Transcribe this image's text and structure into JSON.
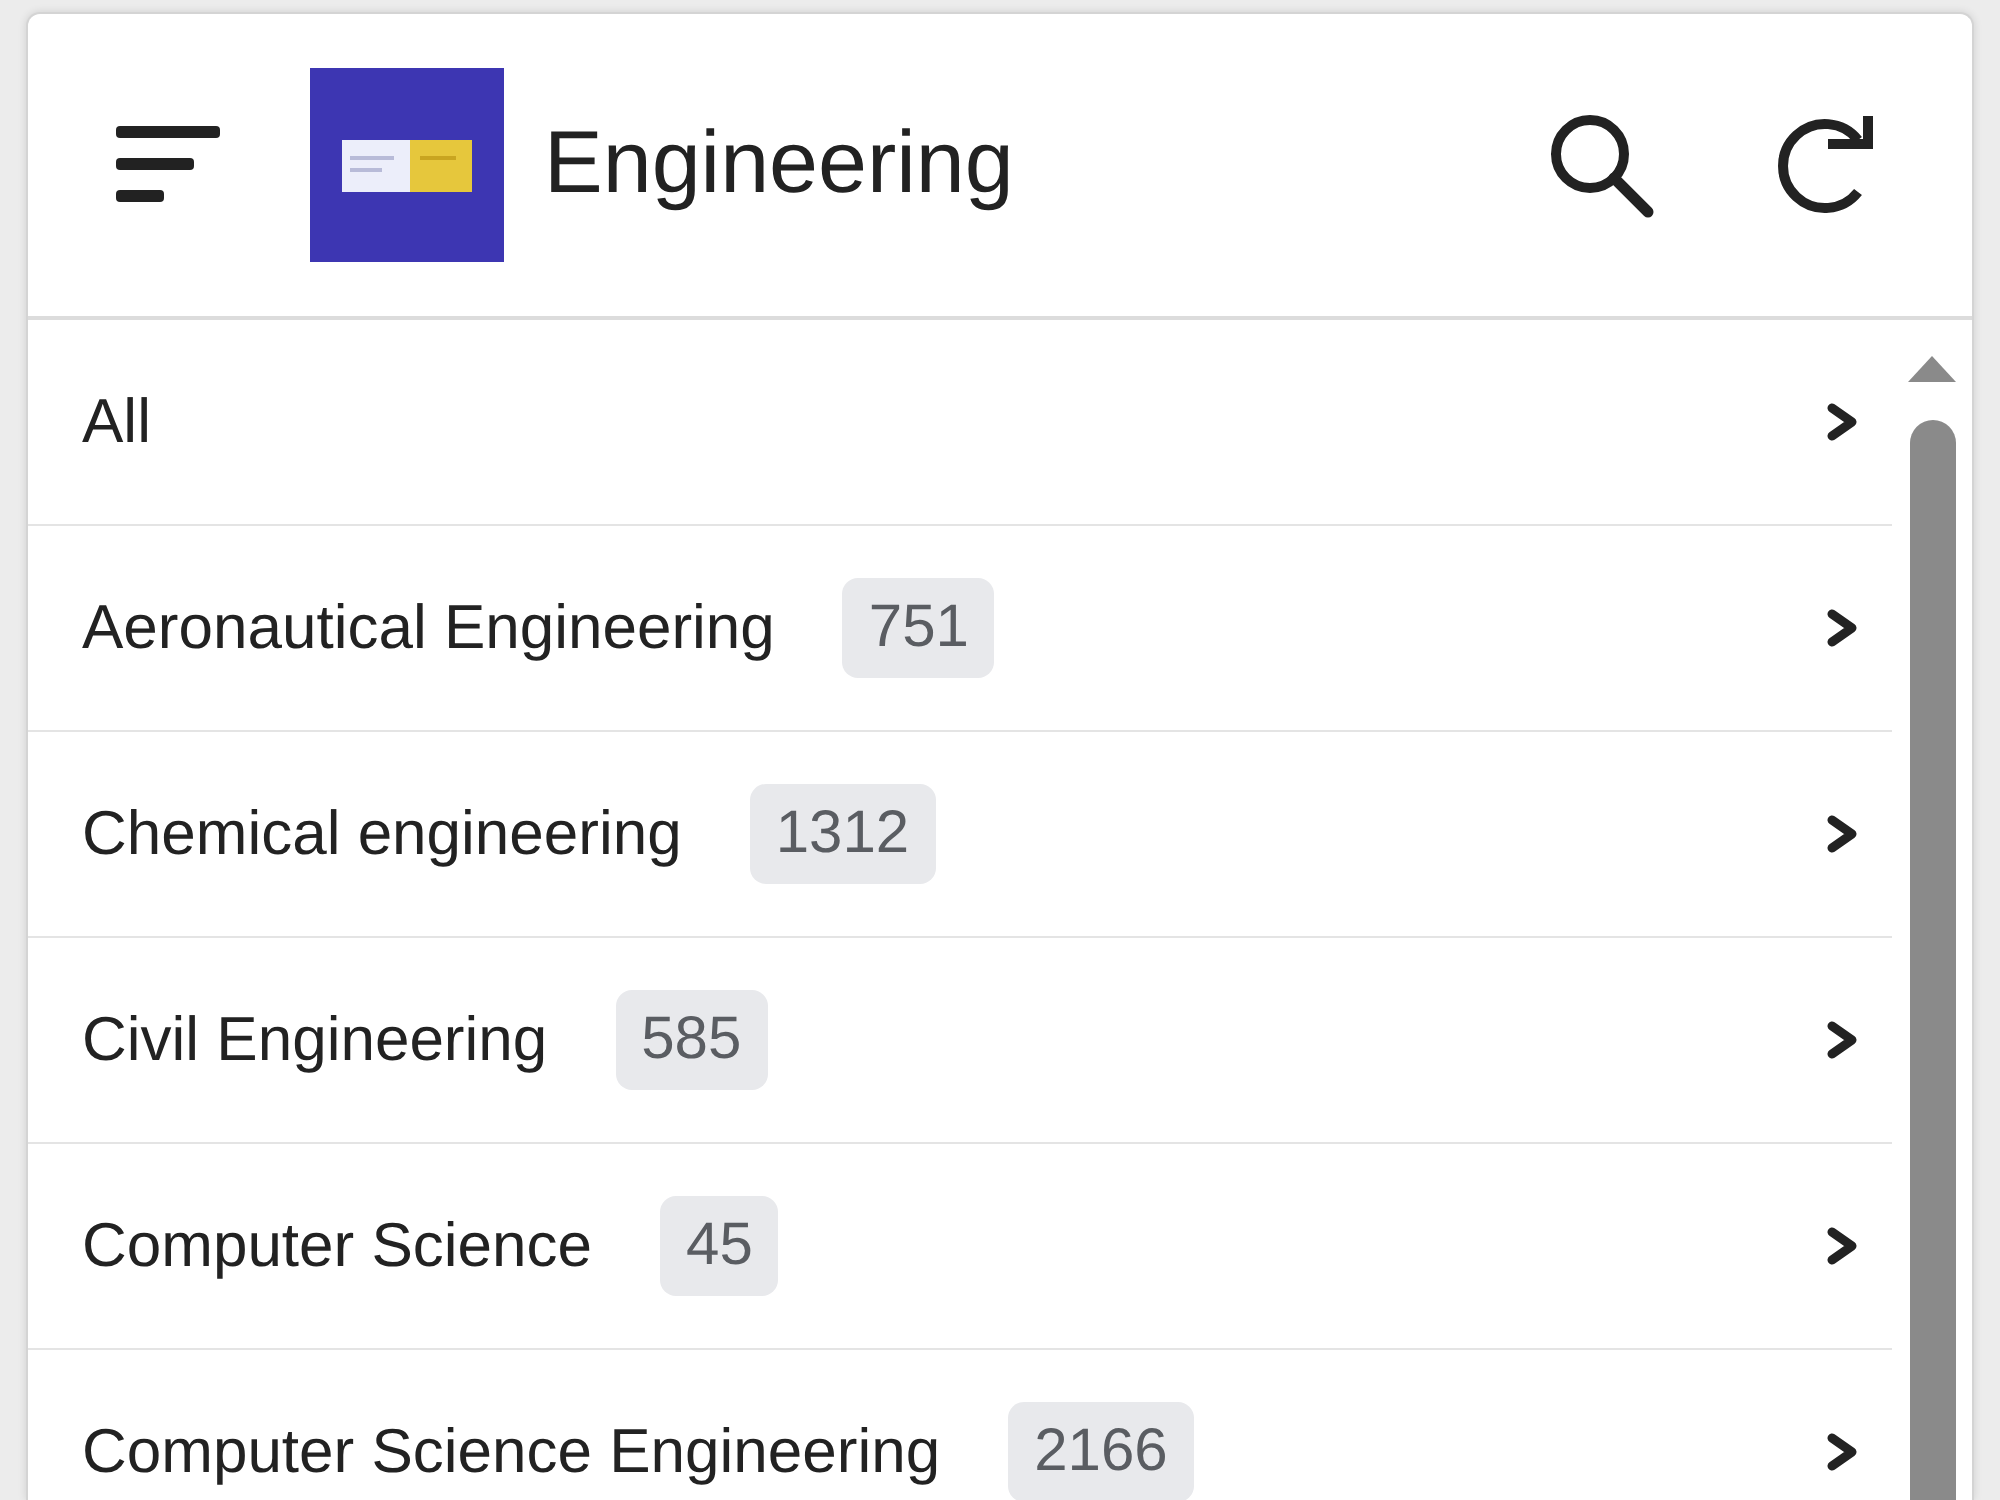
{
  "header": {
    "title": "Engineering"
  },
  "categories": [
    {
      "label": "All"
    },
    {
      "label": "Aeronautical Engineering",
      "count": "751"
    },
    {
      "label": "Chemical engineering",
      "count": "1312"
    },
    {
      "label": "Civil Engineering",
      "count": "585"
    },
    {
      "label": "Computer Science",
      "count": "45"
    },
    {
      "label": "Computer Science Engineering",
      "count": "2166"
    }
  ]
}
